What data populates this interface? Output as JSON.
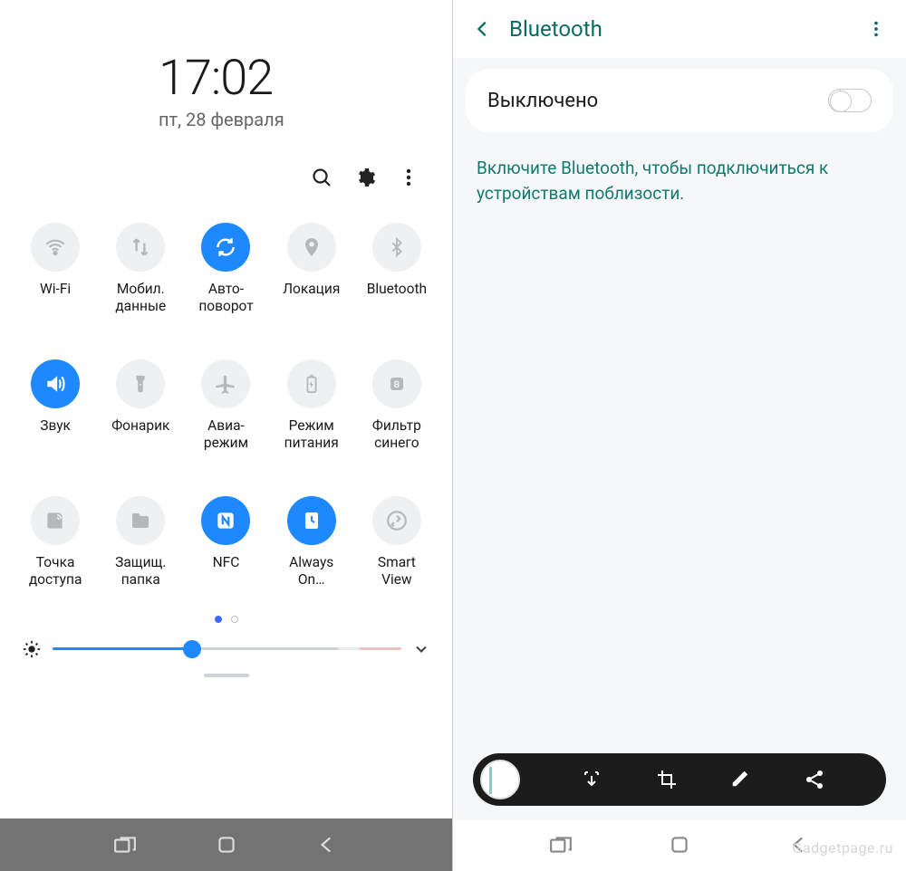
{
  "left": {
    "clock": {
      "time": "17:02",
      "date": "пт, 28 февраля"
    },
    "actions": {
      "search": "search-icon",
      "settings": "gear-icon",
      "more": "more-icon"
    },
    "tiles": [
      {
        "id": "wifi",
        "label": "Wi-Fi",
        "icon": "wifi",
        "on": false
      },
      {
        "id": "mobiledata",
        "label": "Мобил.\nданные",
        "icon": "data",
        "on": false
      },
      {
        "id": "autorotate",
        "label": "Авто-\nповорот",
        "icon": "rotate",
        "on": true
      },
      {
        "id": "location",
        "label": "Локация",
        "icon": "location",
        "on": false
      },
      {
        "id": "bluetooth",
        "label": "Bluetooth",
        "icon": "bluetooth",
        "on": false
      },
      {
        "id": "sound",
        "label": "Звук",
        "icon": "sound",
        "on": true
      },
      {
        "id": "flashlight",
        "label": "Фонарик",
        "icon": "flashlight",
        "on": false
      },
      {
        "id": "airplane",
        "label": "Авиа-\nрежим",
        "icon": "airplane",
        "on": false
      },
      {
        "id": "battery",
        "label": "Режим\nпитания",
        "icon": "battery",
        "on": false
      },
      {
        "id": "bluefilter",
        "label": "Фильтр\nсинего",
        "icon": "bluefilter",
        "on": false
      },
      {
        "id": "hotspot",
        "label": "Точка\nдоступа",
        "icon": "hotspot",
        "on": false
      },
      {
        "id": "secfolder",
        "label": "Защищ.\nпапка",
        "icon": "folder",
        "on": false
      },
      {
        "id": "nfc",
        "label": "NFC",
        "icon": "nfc",
        "on": true
      },
      {
        "id": "aod",
        "label": "Always\nOn…",
        "icon": "aod",
        "on": true
      },
      {
        "id": "smartview",
        "label": "Smart\nView",
        "icon": "smartview",
        "on": false
      }
    ],
    "pager": {
      "total": 2,
      "active": 0
    },
    "brightness": {
      "percent": 40
    }
  },
  "right": {
    "title": "Bluetooth",
    "card": {
      "label": "Выключено",
      "enabled": false
    },
    "hint": "Включите Bluetooth, чтобы подключиться к устройствам поблизости.",
    "watermark": "Gadgetpage.ru"
  }
}
